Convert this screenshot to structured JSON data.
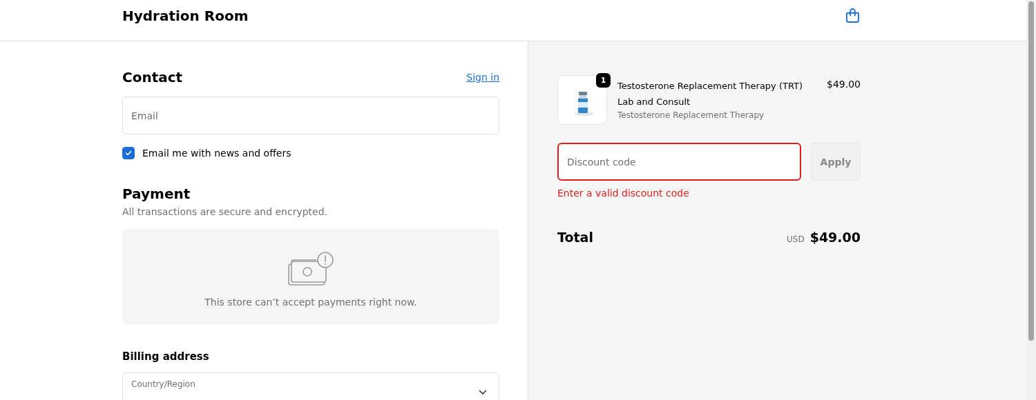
{
  "header": {
    "store_name": "Hydration Room"
  },
  "contact": {
    "title": "Contact",
    "sign_in": "Sign in",
    "email": {
      "placeholder": "Email"
    },
    "newsletter": {
      "label": "Email me with news and offers",
      "checked": true
    }
  },
  "payment": {
    "title": "Payment",
    "subtitle": "All transactions are secure and encrypted.",
    "notice": "This store can’t accept payments right now."
  },
  "billing": {
    "title": "Billing address",
    "country": {
      "label": "Country/Region"
    }
  },
  "order": {
    "items": [
      {
        "kind": "picture",
        "quantity": "1",
        "name": "Testosterone Replacement Therapy (TRT) Lab and Consult",
        "variant": "Testosterone Replacement Therapy",
        "price": "$49.00"
      }
    ],
    "discount": {
      "placeholder": "Discount code",
      "invalid": true,
      "error": "Enter a valid discount code",
      "button": "Apply",
      "disabled": true
    },
    "total": {
      "label": "Total",
      "currency": "USD",
      "amount": "$49.00"
    }
  }
}
